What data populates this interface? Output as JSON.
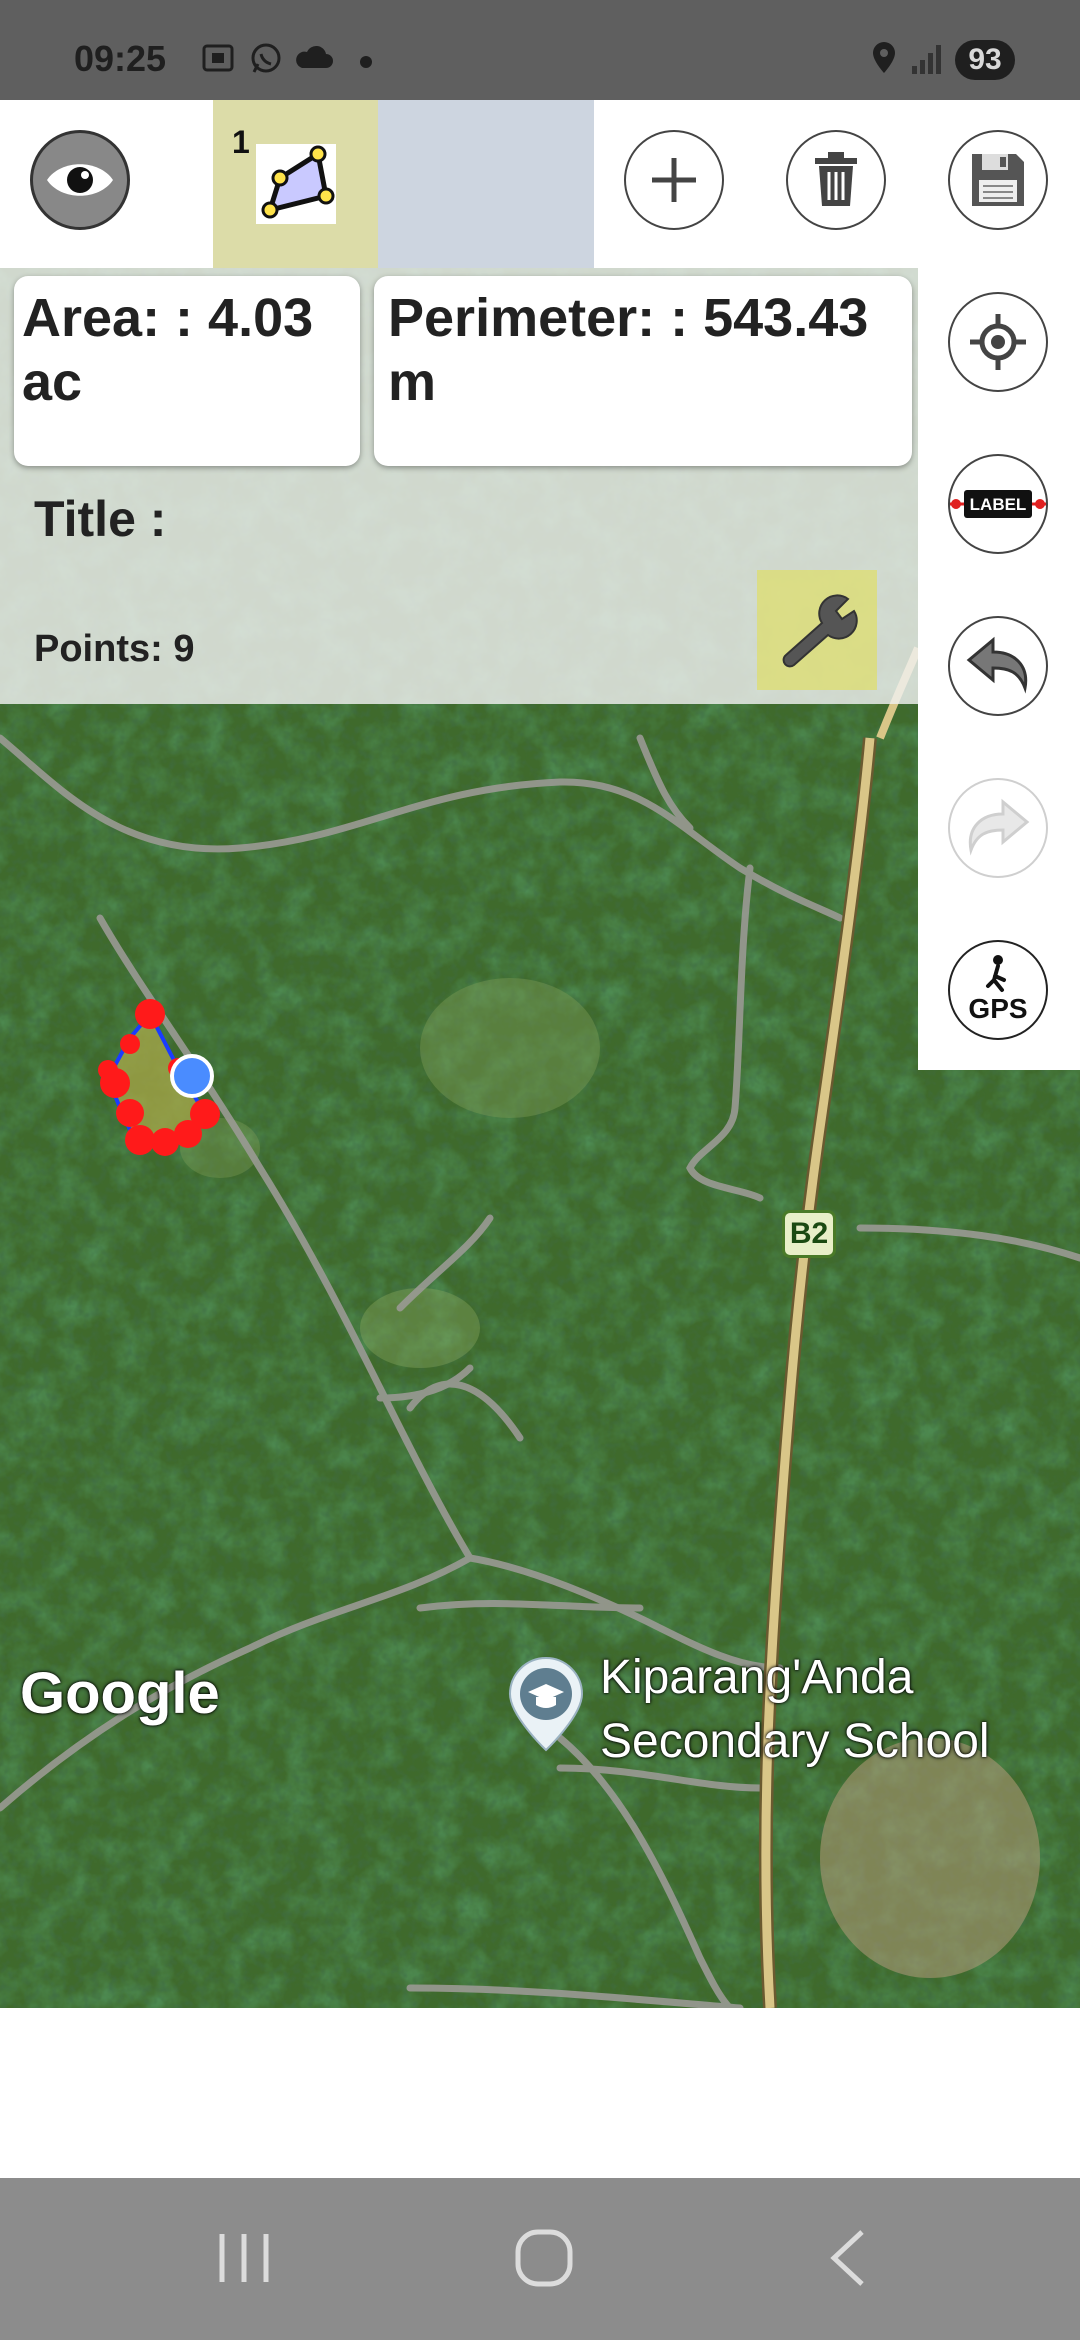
{
  "status": {
    "time": "09:25",
    "battery": "93",
    "icons": [
      "screenshot-icon",
      "whatsapp-icon",
      "cloud-icon",
      "dot-icon",
      "location-icon",
      "signal-icon"
    ]
  },
  "toolbar": {
    "shape_count": "1",
    "buttons": [
      "eye-icon",
      "plus-icon",
      "trash-icon",
      "save-icon"
    ]
  },
  "side_buttons": [
    "locate-icon",
    "label-icon",
    "undo-icon",
    "redo-icon",
    "gps-icon"
  ],
  "side": {
    "label_text": "LABEL",
    "gps_text": "GPS"
  },
  "info": {
    "area_line1": "Area: : 4.03",
    "area_line2": "ac",
    "perimeter_line1": "Perimeter: : 543.43",
    "perimeter_line2": "m",
    "title": "Title :",
    "points": "Points: 9"
  },
  "map": {
    "attribution": "Google",
    "school_line1": "Kiparang'Anda",
    "school_line2": "Secondary School",
    "road_badge": "B2"
  },
  "colors": {
    "status_bar": "#5f5f5f",
    "shape_tab": "#dcdca8",
    "polygon_points": "#ff1a1a",
    "polygon_fill": "#a9a84a",
    "nav_bar": "#8c8c8c"
  }
}
